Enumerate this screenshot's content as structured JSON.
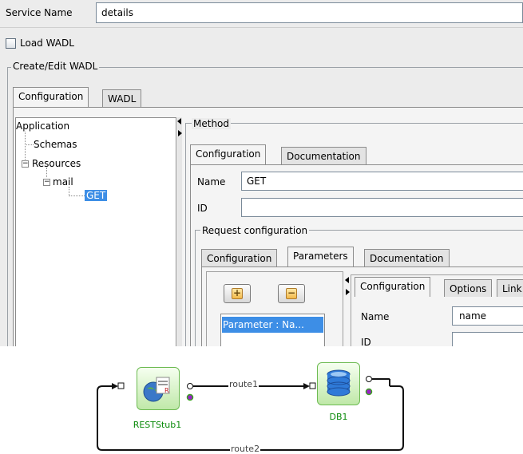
{
  "service": {
    "name_label": "Service Name",
    "name_value": "details"
  },
  "load_wadl": {
    "label": "Load WADL",
    "checked": false
  },
  "create_edit": {
    "legend": "Create/Edit WADL",
    "tabs": [
      "Configuration",
      "WADL"
    ],
    "tree": {
      "root": "Application",
      "schemas": "Schemas",
      "resources": "Resources",
      "mail": "mail",
      "get": "GET"
    }
  },
  "method": {
    "legend": "Method",
    "tabs": [
      "Configuration",
      "Documentation"
    ],
    "name_label": "Name",
    "name_value": "GET",
    "id_label": "ID",
    "id_value": "",
    "request": {
      "legend": "Request configuration",
      "tabs": [
        "Configuration",
        "Parameters",
        "Documentation"
      ],
      "add_symbol": "+",
      "remove_symbol": "−",
      "param_item": "Parameter : Na...",
      "detail_tabs": [
        "Configuration",
        "Options",
        "Link"
      ],
      "param_name_label": "Name",
      "param_name_value": "name",
      "param_id_label": "ID"
    }
  },
  "flow": {
    "nodes": [
      {
        "id": "reststub",
        "label": "RESTStub1",
        "icon": "rest-service-icon"
      },
      {
        "id": "db",
        "label": "DB1",
        "icon": "database-icon"
      }
    ],
    "routes": [
      "route1",
      "route2"
    ]
  },
  "colors": {
    "selection": "#3d8ee6",
    "node_label": "#0a8a0a",
    "panel": "#ececec"
  }
}
